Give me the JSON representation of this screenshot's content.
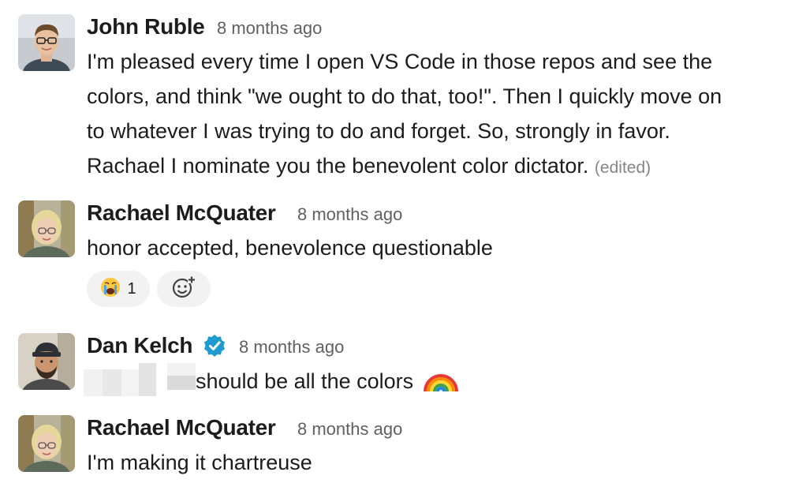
{
  "messages": [
    {
      "author": "John Ruble",
      "time": "8 months ago",
      "lines": [
        "I'm pleased every time I open VS Code in those repos and see the",
        "colors, and think \"we ought to do that, too!\". Then I quickly move on",
        "to whatever I was trying to do and forget. So, strongly in favor.",
        "Rachael I nominate you the benevolent color dictator."
      ],
      "edited_label": "(edited)"
    },
    {
      "author": "Rachael McQuater",
      "time": "8 months ago",
      "text": "honor accepted, benevolence questionable",
      "reactions": [
        {
          "icon": "crying-face-emoji-icon",
          "count": "1"
        }
      ],
      "add_reaction_icon": "add-reaction-icon"
    },
    {
      "author": "Dan Kelch",
      "verified_icon": "verified-badge-icon",
      "time": "8 months ago",
      "text": "should be all the colors",
      "emoji": "rainbow-emoji-icon"
    },
    {
      "author": "Rachael McQuater",
      "time": "8 months ago",
      "text": "I'm making it chartreuse"
    }
  ],
  "colors": {
    "text": "#1d1c1d",
    "timestamp": "#616061",
    "edited": "#868686",
    "reaction_bg": "#f2f2f2",
    "verified": "#1d9bd1"
  }
}
